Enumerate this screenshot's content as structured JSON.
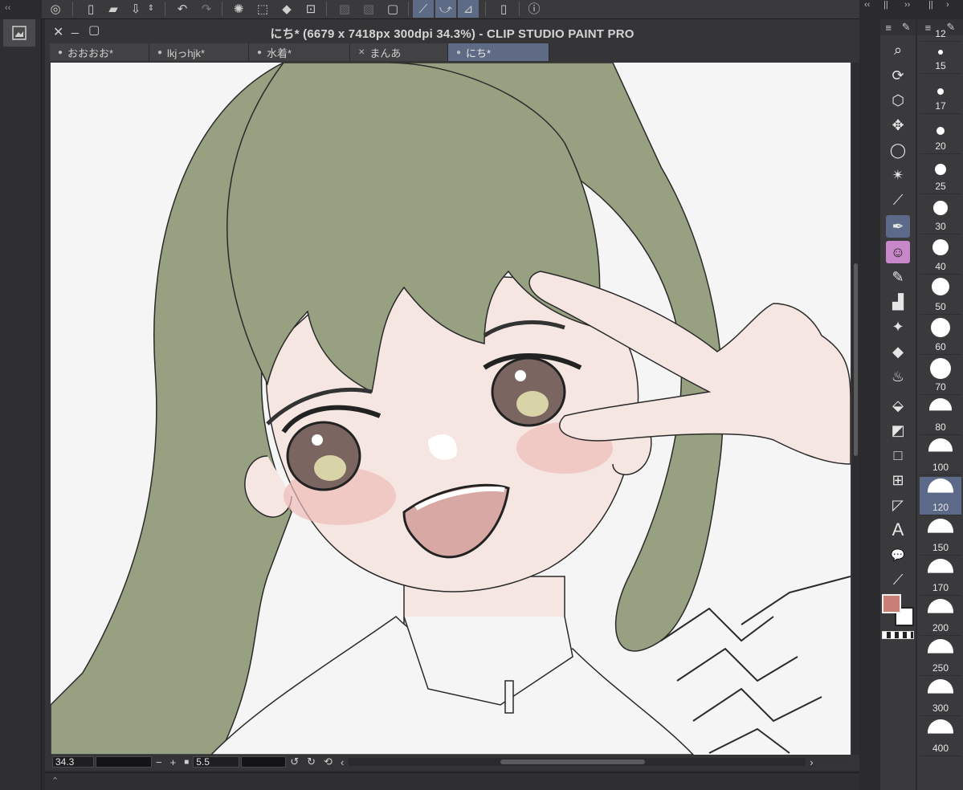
{
  "app": {
    "title": "にち* (6679 x 7418px 300dpi 34.3%)  - CLIP STUDIO PAINT PRO"
  },
  "tabs": [
    {
      "label": "おおおお*",
      "marker": "●",
      "active": false
    },
    {
      "label": "lkjっhjk*",
      "marker": "●",
      "active": false
    },
    {
      "label": "水着*",
      "marker": "●",
      "active": false
    },
    {
      "label": "まんあ",
      "marker": "✕",
      "active": false
    },
    {
      "label": "にち*",
      "marker": "●",
      "active": true
    }
  ],
  "status": {
    "zoom": "34.3",
    "brush_value": "5.5"
  },
  "colors": {
    "main_color": "#c97e76",
    "sub_color": "#ffffff",
    "accent": "#5c6988",
    "hair": "#97a080",
    "skin": "#f6e6e2"
  },
  "tools": [
    {
      "name": "zoom-icon",
      "glyph": "⌕"
    },
    {
      "name": "rotate-icon",
      "glyph": "⟳"
    },
    {
      "name": "object-icon",
      "glyph": "⬡"
    },
    {
      "name": "move-icon",
      "glyph": "✥"
    },
    {
      "name": "lasso-icon",
      "glyph": "◯"
    },
    {
      "name": "magic-wand-icon",
      "glyph": "✴"
    },
    {
      "name": "eyedropper-icon",
      "glyph": "⟋"
    },
    {
      "name": "pen-icon",
      "glyph": "✒"
    },
    {
      "name": "pencil-icon",
      "glyph": "☺"
    },
    {
      "name": "brush-icon",
      "glyph": "✎"
    },
    {
      "name": "airbrush-icon",
      "glyph": "▟"
    },
    {
      "name": "decoration-icon",
      "glyph": "✦"
    },
    {
      "name": "eraser-icon",
      "glyph": "◆"
    },
    {
      "name": "blend-icon",
      "glyph": "♨"
    },
    {
      "name": "fill-icon",
      "glyph": "⬙"
    },
    {
      "name": "gradient-icon",
      "glyph": "◩"
    },
    {
      "name": "figure-icon",
      "glyph": "□"
    },
    {
      "name": "frame-icon",
      "glyph": "⊞"
    },
    {
      "name": "ruler-icon",
      "glyph": "◸"
    },
    {
      "name": "text-icon",
      "glyph": "A"
    },
    {
      "name": "balloon-icon",
      "glyph": "💬"
    },
    {
      "name": "correct-line-icon",
      "glyph": "⟋"
    }
  ],
  "brush_sizes": [
    "12",
    "15",
    "17",
    "20",
    "25",
    "30",
    "40",
    "50",
    "60",
    "70",
    "80",
    "100",
    "120",
    "150",
    "170",
    "200",
    "250",
    "300",
    "400"
  ],
  "active_size": "120"
}
